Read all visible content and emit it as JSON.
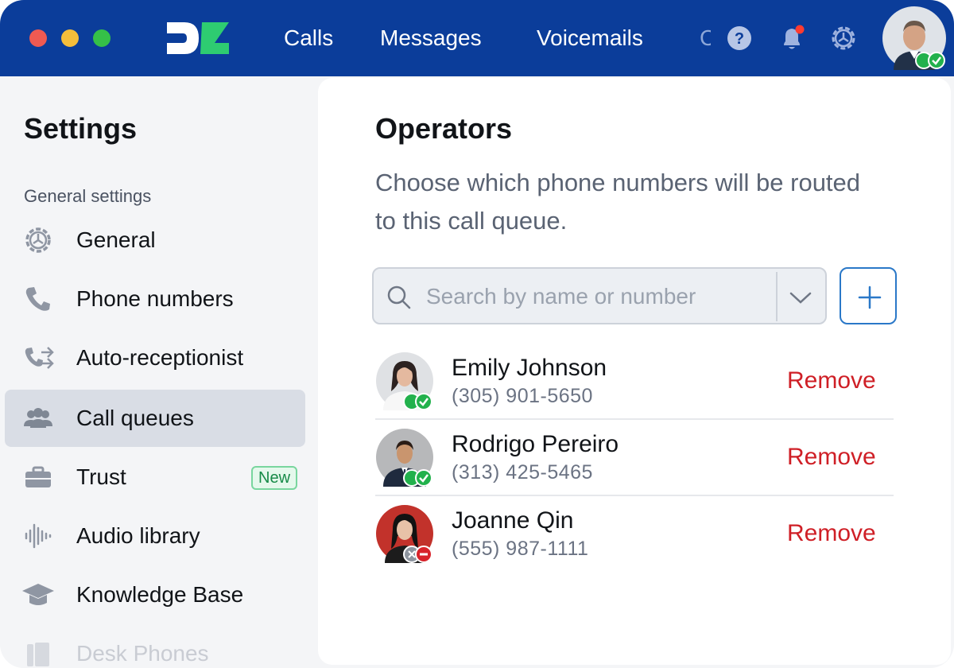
{
  "topbar": {
    "nav": [
      {
        "label": "Calls"
      },
      {
        "label": "Messages"
      },
      {
        "label": "Voicemails"
      }
    ],
    "help_icon_glyph": "?",
    "colors": {
      "bar": "#0b3d9a",
      "notification_dot": "#ff3b30",
      "online": "#22b14c"
    },
    "icons": [
      "help-icon",
      "bell-icon",
      "gear-icon",
      "user-avatar"
    ]
  },
  "sidebar": {
    "title": "Settings",
    "section_label": "General settings",
    "items": [
      {
        "label": "General",
        "icon": "gear-icon"
      },
      {
        "label": "Phone numbers",
        "icon": "phone-icon"
      },
      {
        "label": "Auto-receptionist",
        "icon": "auto-receptionist-icon"
      },
      {
        "label": "Call queues",
        "icon": "users-icon",
        "active": true
      },
      {
        "label": "Trust",
        "icon": "briefcase-icon",
        "badge": "New"
      },
      {
        "label": "Audio library",
        "icon": "audio-waveform-icon"
      },
      {
        "label": "Knowledge Base",
        "icon": "graduation-cap-icon"
      },
      {
        "label": "Desk Phones",
        "icon": "desk-phone-icon"
      }
    ]
  },
  "main": {
    "title": "Operators",
    "description": "Choose which phone numbers will be routed to this call queue.",
    "search": {
      "placeholder": "Search by name or number",
      "value": ""
    },
    "operators": [
      {
        "name": "Emily Johnson",
        "phone": "(305) 901-5650",
        "status": "available",
        "action": "Remove"
      },
      {
        "name": "Rodrigo Pereiro",
        "phone": "(313) 425-5465",
        "status": "available",
        "action": "Remove"
      },
      {
        "name": "Joanne Qin",
        "phone": "(555) 987-1111",
        "status": "do-not-disturb",
        "action": "Remove"
      }
    ]
  }
}
